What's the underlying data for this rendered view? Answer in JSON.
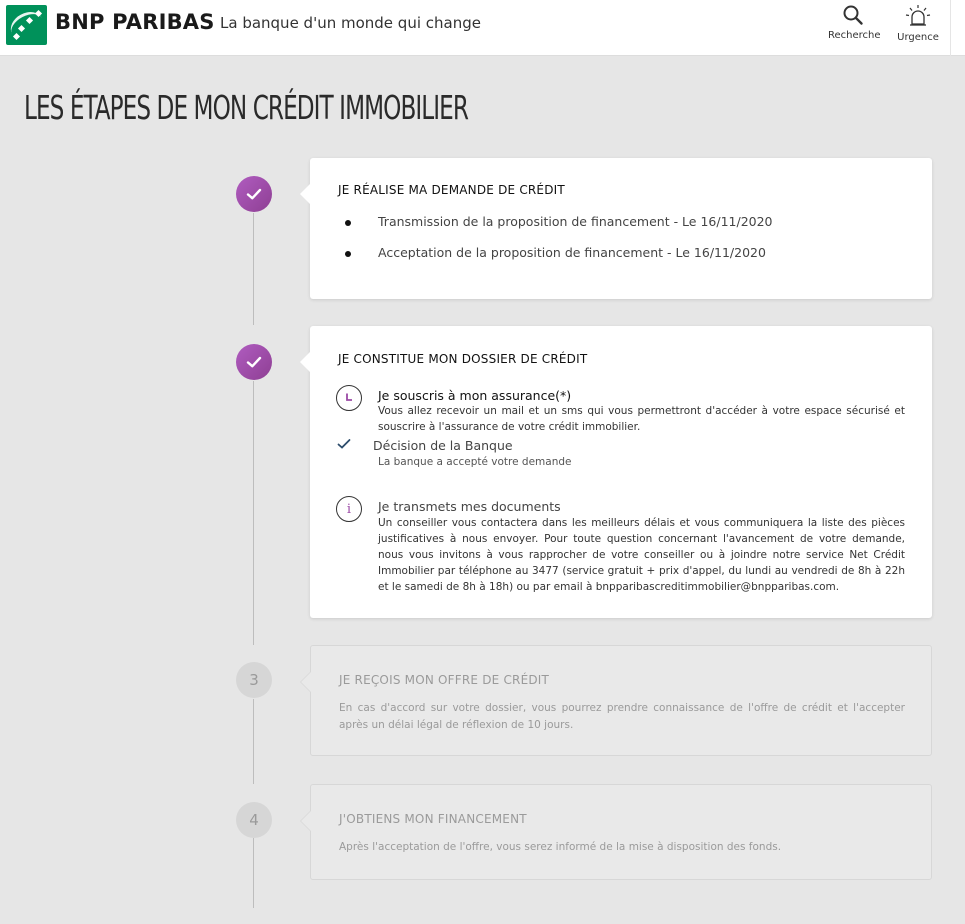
{
  "header": {
    "brand": "BNP PARIBAS",
    "tagline": "La banque d'un monde qui change",
    "search_label": "Recherche",
    "urgency_label": "Urgence",
    "brand_color": "#00915a"
  },
  "page_title": "LES ÉTAPES DE MON CRÉDIT IMMOBILIER",
  "steps": [
    {
      "status": "done",
      "title": "JE RÉALISE MA DEMANDE DE CRÉDIT",
      "items": [
        "Transmission de la proposition de financement - Le 16/11/2020",
        "Acceptation de la proposition de financement - Le 16/11/2020"
      ]
    },
    {
      "status": "done",
      "title": "JE CONSTITUE MON DOSSIER DE CRÉDIT",
      "insurance": {
        "title": "Je souscris à mon assurance(*)",
        "text": "Vous allez recevoir un mail et un sms qui vous permettront d'accéder à votre espace sécurisé et souscrire à l'assurance de votre crédit immobilier.",
        "icon": "clock-icon"
      },
      "decision": {
        "title": "Décision de la Banque",
        "text": "La banque a accepté votre demande",
        "icon": "check-icon"
      },
      "documents": {
        "title": "Je transmets mes documents",
        "text": "Un conseiller vous contactera dans les meilleurs délais et vous communiquera la liste des pièces justificatives à nous envoyer. Pour toute question concernant l'avancement de votre demande, nous vous invitons à vous rapprocher de votre conseiller ou à joindre notre service Net Crédit Immobilier par téléphone au 3477 (service gratuit + prix d'appel, du lundi au vendredi de 8h à 22h et le samedi de 8h à 18h) ou par email à bnpparibascreditimmobilier@bnpparibas.com.",
        "icon": "info-icon"
      }
    },
    {
      "status": "todo",
      "number": "3",
      "title": "JE REÇOIS MON OFFRE DE CRÉDIT",
      "text": "En cas d'accord sur votre dossier, vous pourrez prendre connaissance de l'offre de crédit et l'accepter après un délai légal de réflexion de 10 jours."
    },
    {
      "status": "todo",
      "number": "4",
      "title": "J'OBTIENS MON FINANCEMENT",
      "text": "Après l'acceptation de l'offre, vous serez informé de la mise à disposition des fonds."
    }
  ],
  "colors": {
    "accent_purple": "#9b4aa6",
    "background": "#e6e6e6"
  }
}
